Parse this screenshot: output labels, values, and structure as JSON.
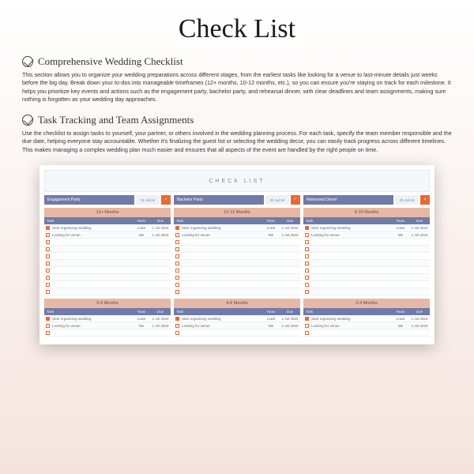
{
  "title": "Check List",
  "sections": [
    {
      "heading": "Comprehensive Wedding Checklist",
      "body": "This section allows you to organize your wedding preparations across different stages, from the earliest tasks like looking for a venue to last-minute details just weeks before the big day. Break down your to-dos into manageable timeframes (12+ months, 10-12 months, etc.), so you can ensure you're staying on track for each milestone. It helps you prioritize key events and actions such as the engagement party, bachelor party, and rehearsal dinner, with clear deadlines and team assignments, making sure nothing is forgotten as your wedding day approaches."
    },
    {
      "heading": "Task Tracking and Team Assignments",
      "body": "Use the checklist to assign tasks to yourself, your partner, or others involved in the wedding planning process. For each task, specify the team member responsible and the due date, helping everyone stay accountable. Whether it's finalizing the guest list or selecting the wedding decor, you can easily track progress across different timelines. This makes managing a complex wedding plan much easier and ensures that all aspects of the event are handled by the right people on time."
    }
  ],
  "screenshot": {
    "header": "CHECK LIST",
    "events": [
      {
        "name": "Engagement Party",
        "date": "21 Jul 24",
        "btn": "+"
      },
      {
        "name": "Bachelor Party",
        "date": "21 Jul 24",
        "btn": "+"
      },
      {
        "name": "Rehearsal Dinner",
        "date": "21 Jul 24",
        "btn": "×"
      }
    ],
    "row1": [
      {
        "title": "12+ Months"
      },
      {
        "title": "10-12 Months"
      },
      {
        "title": "8-10 Months"
      }
    ],
    "row2": [
      {
        "title": "6-8 Months"
      },
      {
        "title": "4-6 Months"
      },
      {
        "title": "2-4 Months"
      }
    ],
    "subhead": {
      "task": "Task",
      "team": "Team",
      "due": "Due"
    },
    "tasks": [
      {
        "done": true,
        "name": "Start organising wedding",
        "team": "Lowe",
        "due": "1 Jul 2023"
      },
      {
        "done": false,
        "name": "Looking for venue",
        "team": "Me",
        "due": "1 Jul 2023"
      }
    ]
  }
}
